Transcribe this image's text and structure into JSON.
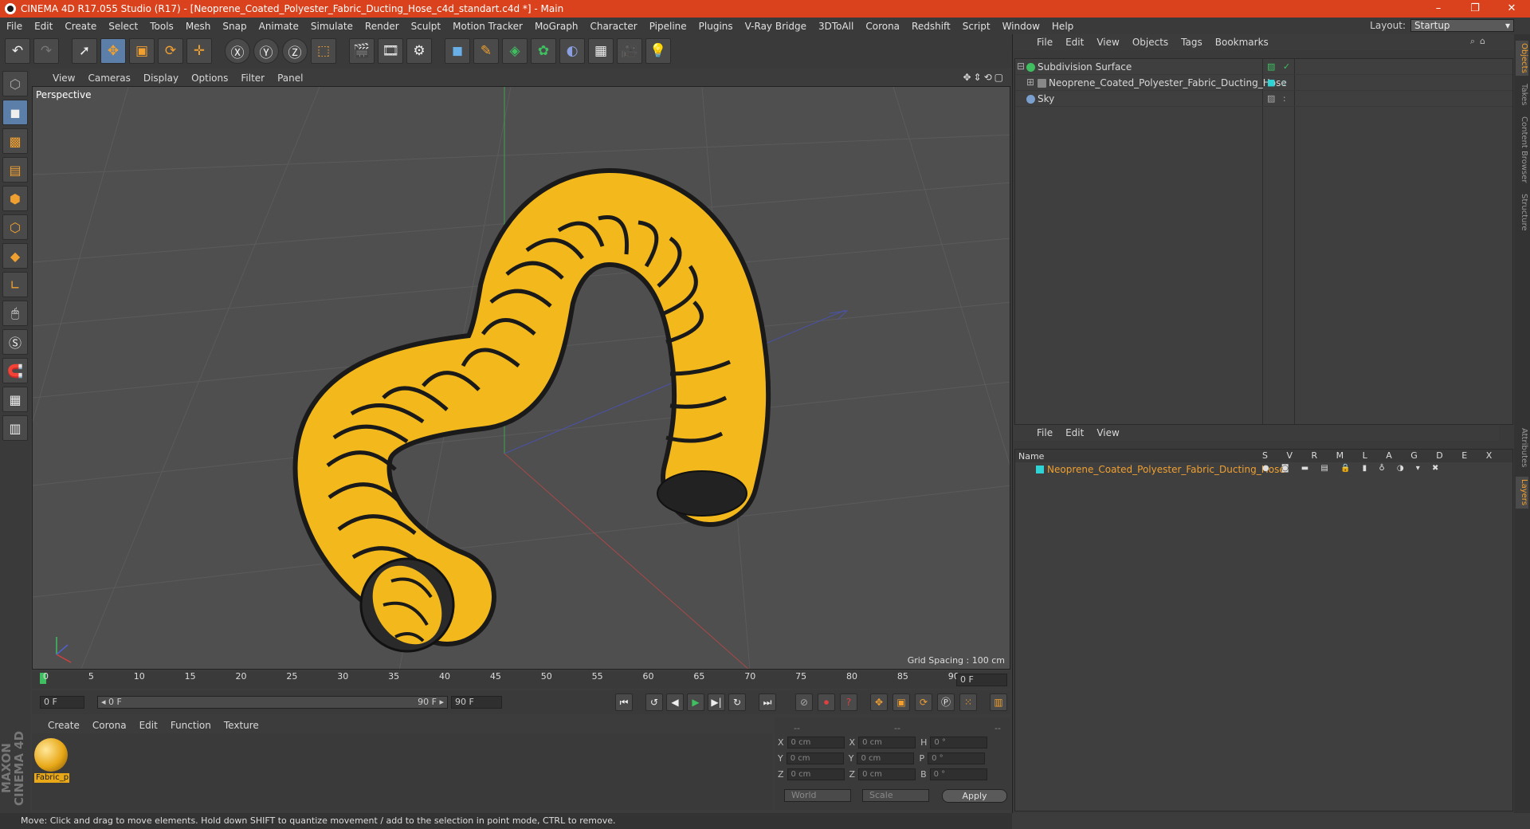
{
  "title": "CINEMA 4D R17.055 Studio (R17) - [Neoprene_Coated_Polyester_Fabric_Ducting_Hose_c4d_standart.c4d *] - Main",
  "window_buttons": [
    "–",
    "❐",
    "✕"
  ],
  "menu": [
    "File",
    "Edit",
    "Create",
    "Select",
    "Tools",
    "Mesh",
    "Snap",
    "Animate",
    "Simulate",
    "Render",
    "Sculpt",
    "Motion Tracker",
    "MoGraph",
    "Character",
    "Pipeline",
    "Plugins",
    "V-Ray Bridge",
    "3DToAll",
    "Corona",
    "Redshift",
    "Script",
    "Window",
    "Help"
  ],
  "layout": {
    "label": "Layout:",
    "value": "Startup"
  },
  "viewport": {
    "menu": [
      "View",
      "Cameras",
      "Display",
      "Options",
      "Filter",
      "Panel"
    ],
    "label": "Perspective",
    "grid_spacing": "Grid Spacing : 100 cm",
    "nav_icons": "✥⇕⟲▢"
  },
  "timeline": {
    "ticks": [
      "0",
      "5",
      "10",
      "15",
      "20",
      "25",
      "30",
      "35",
      "40",
      "45",
      "50",
      "55",
      "60",
      "65",
      "70",
      "75",
      "80",
      "85",
      "90"
    ],
    "current": "0 F"
  },
  "transport": {
    "start": "0 F",
    "range_start": "◂ 0 F",
    "range_end": "90 F ▸",
    "end": "90 F"
  },
  "material_manager": {
    "menu": [
      "Create",
      "Corona",
      "Edit",
      "Function",
      "Texture"
    ],
    "material": "Fabric_p"
  },
  "coordinates": {
    "headers": [
      "--",
      "--",
      "--"
    ],
    "rows": [
      {
        "a": "X",
        "av": "0 cm",
        "b": "X",
        "bv": "0 cm",
        "c": "H",
        "cv": "0 °"
      },
      {
        "a": "Y",
        "av": "0 cm",
        "b": "Y",
        "bv": "0 cm",
        "c": "P",
        "cv": "0 °"
      },
      {
        "a": "Z",
        "av": "0 cm",
        "b": "Z",
        "bv": "0 cm",
        "c": "B",
        "cv": "0 °"
      }
    ],
    "mode1": "World",
    "mode2": "Scale",
    "apply": "Apply"
  },
  "status": "Move: Click and drag to move elements. Hold down SHIFT to quantize movement / add to the selection in point mode, CTRL to remove.",
  "maxon": "MAXON CINEMA 4D",
  "object_manager": {
    "menu": [
      "File",
      "Edit",
      "View",
      "Objects",
      "Tags",
      "Bookmarks"
    ],
    "objects": [
      {
        "name": "Subdivision Surface",
        "color": "#3fbf60",
        "tags": "▨ ✓"
      },
      {
        "name": "Neoprene_Coated_Polyester_Fabric_Ducting_Hose",
        "color": "#888888",
        "tags": "■ :"
      },
      {
        "name": "Sky",
        "color": "#7aa0d0",
        "tags": "▨ :"
      }
    ]
  },
  "layer_manager": {
    "menu": [
      "File",
      "Edit",
      "View"
    ],
    "header_name": "Name",
    "columns": "S V R M L A G D E X",
    "layer": "Neoprene_Coated_Polyester_Fabric_Ducting_Hose",
    "layer_color": "#2fd3d3"
  },
  "side_tabs": [
    "Objects",
    "Takes",
    "Content Browser",
    "Structure",
    "Attributes",
    "Layers"
  ]
}
